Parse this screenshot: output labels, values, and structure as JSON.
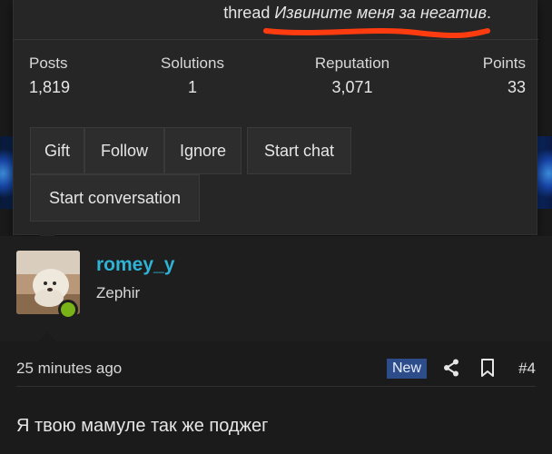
{
  "popup": {
    "thread_prefix": "thread",
    "thread_title": "Извините меня за негатив",
    "thread_suffix": ".",
    "stats": [
      {
        "label": "Posts",
        "value": "1,819"
      },
      {
        "label": "Solutions",
        "value": "1"
      },
      {
        "label": "Reputation",
        "value": "3,071"
      },
      {
        "label": "Points",
        "value": "33"
      }
    ],
    "buttons": {
      "gift": "Gift",
      "follow": "Follow",
      "ignore": "Ignore",
      "start_chat": "Start chat",
      "start_conversation": "Start conversation"
    },
    "annotation_color": "#ff3b10"
  },
  "post": {
    "username": "romey_y",
    "user_title": "Zephir",
    "username_color": "#2eb3d6",
    "online_color": "#7ab317",
    "time": "25 minutes ago",
    "badge": "New",
    "number": "#4",
    "text": "Я твою мамуле так же поджег",
    "icons": [
      "share-icon",
      "bookmark-icon"
    ]
  }
}
